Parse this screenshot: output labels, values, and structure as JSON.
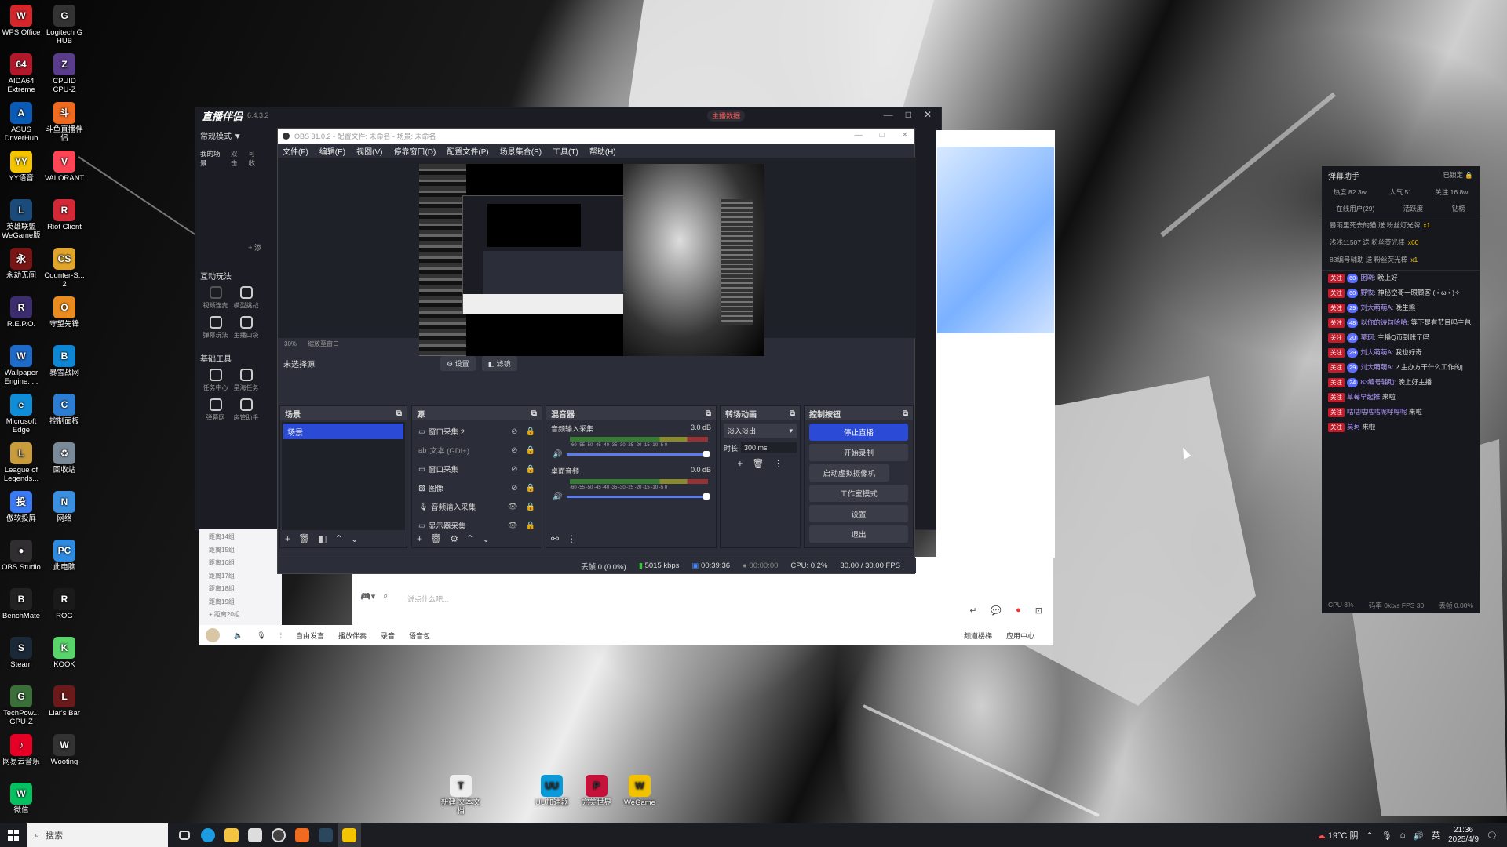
{
  "desktop_icons": [
    {
      "label": "WPS Office",
      "color": "#d4262b",
      "glyph": "W"
    },
    {
      "label": "Logitech G HUB",
      "color": "#333",
      "glyph": "G"
    },
    {
      "label": "AIDA64 Extreme",
      "color": "#b3182a",
      "glyph": "64"
    },
    {
      "label": "CPUID CPU-Z",
      "color": "#5a3d8a",
      "glyph": "Z"
    },
    {
      "label": "ASUS DriverHub",
      "color": "#0a5bb6",
      "glyph": "A"
    },
    {
      "label": "斗鱼直播伴侣",
      "color": "#f06a1f",
      "glyph": "斗"
    },
    {
      "label": "YY语音",
      "color": "#f5c400",
      "glyph": "YY"
    },
    {
      "label": "VALORANT",
      "color": "#fd4556",
      "glyph": "V"
    },
    {
      "label": "英雄联盟WeGame版",
      "color": "#1b4b7a",
      "glyph": "L"
    },
    {
      "label": "Riot Client",
      "color": "#d32936",
      "glyph": "R"
    },
    {
      "label": "永劫无间",
      "color": "#7a1515",
      "glyph": "永"
    },
    {
      "label": "Counter-S... 2",
      "color": "#e0a52a",
      "glyph": "CS"
    },
    {
      "label": "R.E.P.O.",
      "color": "#3c2d6e",
      "glyph": "R"
    },
    {
      "label": "守望先锋",
      "color": "#e98b1e",
      "glyph": "O"
    },
    {
      "label": "Wallpaper Engine: ...",
      "color": "#1e6ac8",
      "glyph": "W"
    },
    {
      "label": "暴雪战网",
      "color": "#0e86d4",
      "glyph": "B"
    },
    {
      "label": "Microsoft Edge",
      "color": "#0f8dd6",
      "glyph": "e"
    },
    {
      "label": "控制面板",
      "color": "#2d7dd2",
      "glyph": "C"
    },
    {
      "label": "League of Legends...",
      "color": "#c89b3c",
      "glyph": "L"
    },
    {
      "label": "回收站",
      "color": "#7a8a99",
      "glyph": "♻"
    },
    {
      "label": "傲软投屏",
      "color": "#3a7bf5",
      "glyph": "投"
    },
    {
      "label": "网络",
      "color": "#3a8fe0",
      "glyph": "N"
    },
    {
      "label": "OBS Studio",
      "color": "#302e31",
      "glyph": "●"
    },
    {
      "label": "此电脑",
      "color": "#2e8be0",
      "glyph": "PC"
    },
    {
      "label": "BenchMate",
      "color": "#222",
      "glyph": "B"
    },
    {
      "label": "ROG",
      "color": "#1a1a1a",
      "glyph": "R"
    },
    {
      "label": "Steam",
      "color": "#1b2838",
      "glyph": "S"
    },
    {
      "label": "KOOK",
      "color": "#58d46a",
      "glyph": "K"
    },
    {
      "label": "TechPow... GPU-Z",
      "color": "#3b6f3a",
      "glyph": "G"
    },
    {
      "label": "Liar's Bar",
      "color": "#6a1a1a",
      "glyph": "L"
    },
    {
      "label": "网易云音乐",
      "color": "#e60026",
      "glyph": "♪"
    },
    {
      "label": "Wooting",
      "color": "#333",
      "glyph": "W"
    },
    {
      "label": "微信",
      "color": "#07c160",
      "glyph": "W"
    }
  ],
  "desktop_bottom_icons": [
    {
      "label": "新建 文本文档",
      "color": "#eee",
      "glyph": "T"
    },
    {
      "label": "UU加速器",
      "color": "#0b9ad9",
      "glyph": "UU"
    },
    {
      "label": "完美世界",
      "color": "#c4123b",
      "glyph": "P"
    },
    {
      "label": "WeGame",
      "color": "#f2c200",
      "glyph": "W"
    }
  ],
  "companion": {
    "title": "直播伴侣",
    "version": "6.4.3.2",
    "mode": "常规模式 ▼",
    "tabs": [
      "我的场景",
      "双击",
      "可收"
    ],
    "add_label": "+ 添",
    "sec_interact": "互动玩法",
    "interact_items": [
      "视频连麦",
      "模型挑战",
      "弹幕玩法",
      "主播口袋"
    ],
    "sec_tools": "基础工具",
    "tool_items": [
      "任务中心",
      "星海任务",
      "弹幕网",
      "房管助手"
    ],
    "list": [
      "距离14组",
      "距离15组",
      "距离16组",
      "距离17组",
      "距离18组",
      "距离19组",
      "+ 距离20组"
    ],
    "live_data_btn": "主播数据",
    "bottom_items": [
      "自由发言",
      "播放伴奏",
      "录音",
      "语音包",
      "频道楼梯",
      "应用中心"
    ],
    "input_placeholder": "说点什么吧..."
  },
  "obs": {
    "title": "OBS 31.0.2 - 配置文件: 未命名 - 场景: 未命名",
    "menu": [
      "文件(F)",
      "编辑(E)",
      "视图(V)",
      "停靠窗口(D)",
      "配置文件(P)",
      "场景集合(S)",
      "工具(T)",
      "帮助(H)"
    ],
    "zoom": "30%",
    "zoom_mode": "缩放至窗口",
    "no_source": "未选择源",
    "btn_settings": "设置",
    "btn_filters": "滤镜",
    "docks": {
      "scenes": {
        "title": "场景",
        "items": [
          "场景"
        ]
      },
      "sources": {
        "title": "源",
        "items": [
          "窗口采集 2",
          "文本 (GDI+)",
          "窗口采集",
          "图像",
          "音频输入采集",
          "显示器采集"
        ]
      },
      "mixer": {
        "title": "混音器",
        "ch": [
          {
            "name": "音频输入采集",
            "db": "3.0 dB"
          },
          {
            "name": "桌面音频",
            "db": "0.0 dB"
          }
        ],
        "scale": "-60 -55 -50 -45 -40 -35 -30 -25 -20 -15 -10 -5 0"
      },
      "transitions": {
        "title": "转场动画",
        "type": "淡入淡出",
        "duration_label": "时长",
        "duration": "300 ms"
      },
      "controls": {
        "title": "控制按钮",
        "buttons": [
          "停止直播",
          "开始录制",
          "启动虚拟摄像机",
          "工作室模式",
          "设置",
          "退出"
        ]
      }
    },
    "status": {
      "frames": "丢帧 0 (0.0%)",
      "bitrate": "5015 kbps",
      "live_time": "00:39:36",
      "rec_time": "00:00:00",
      "cpu": "CPU: 0.2%",
      "fps": "30.00 / 30.00 FPS"
    }
  },
  "danmu": {
    "title": "弹幕助手",
    "locked": "已锁定",
    "stats": [
      "热度 82.3w",
      "人气 51",
      "关注 16.8w"
    ],
    "tabs": [
      "在线用户(29)",
      "活跃度",
      "钻榜"
    ],
    "gifts": [
      {
        "text": "暴雨里死去的猫 送 粉丝灯光牌",
        "count": "x1"
      },
      {
        "text": "浅浅11507 送 粉丝荧光棒",
        "count": "x60"
      },
      {
        "text": "83编号辅助 送 粉丝荧光棒",
        "count": "x1"
      }
    ],
    "messages": [
      {
        "tag": "关注",
        "lv": "60",
        "name": "困晓:",
        "text": "晚上好"
      },
      {
        "tag": "关注",
        "lv": "60",
        "name": "野牧:",
        "text": "神秘空哥一眼顾客 ( •̀ ω •́ )✧"
      },
      {
        "tag": "关注",
        "lv": "29",
        "name": "刘大萌萌A:",
        "text": "晚生熊"
      },
      {
        "tag": "关注",
        "lv": "48",
        "name": "以你的诗句哈哈:",
        "text": "等下是有节目吗主包"
      },
      {
        "tag": "关注",
        "lv": "20",
        "name": "莫珂:",
        "text": "主播Q币到账了吗"
      },
      {
        "tag": "关注",
        "lv": "29",
        "name": "刘大萌萌A:",
        "text": "我也好奇"
      },
      {
        "tag": "关注",
        "lv": "29",
        "name": "刘大萌萌A:",
        "text": "? 主办方干什么工作的]"
      },
      {
        "tag": "关注",
        "lv": "24",
        "name": "83编号辅助:",
        "text": "晚上好主播"
      },
      {
        "tag": "关注",
        "lv": "",
        "name": "草莓早起推",
        "text": "来啦"
      },
      {
        "tag": "关注",
        "lv": "",
        "name": "咕咕咕咕咕呢呼呼呢",
        "text": "来啦"
      },
      {
        "tag": "关注",
        "lv": "",
        "name": "莫珂",
        "text": "来啦"
      }
    ],
    "footer": [
      "CPU 3%",
      "码率 0kb/s FPS 30",
      "丢帧 0.00%"
    ]
  },
  "taskbar": {
    "search": "搜索",
    "weather": "19°C 阴",
    "lang": "英",
    "time": "21:36",
    "date": "2025/4/9"
  }
}
